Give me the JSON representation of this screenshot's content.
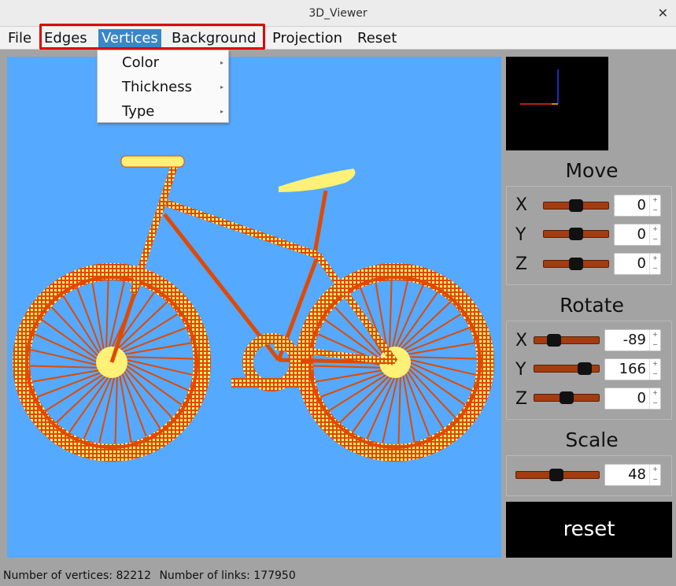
{
  "window": {
    "title": "3D_Viewer"
  },
  "menu": {
    "items": [
      {
        "label": "File"
      },
      {
        "label": "Edges"
      },
      {
        "label": "Vertices"
      },
      {
        "label": "Background"
      },
      {
        "label": "Projection"
      },
      {
        "label": "Reset"
      }
    ],
    "active": "Vertices",
    "dropdown": [
      "Color",
      "Thickness",
      "Type"
    ]
  },
  "colors": {
    "viewport_background": "#55a9ff",
    "edges": "#e04a00",
    "vertices": "#fff176",
    "slider": "#a33c10",
    "highlight": "#e00000",
    "menu_active": "#3a86c8"
  },
  "controls": {
    "move": {
      "title": "Move",
      "axes": [
        {
          "label": "X",
          "value": "0",
          "level": 0.5
        },
        {
          "label": "Y",
          "value": "0",
          "level": 0.5
        },
        {
          "label": "Z",
          "value": "0",
          "level": 0.5
        }
      ]
    },
    "rotate": {
      "title": "Rotate",
      "axes": [
        {
          "label": "X",
          "value": "-89",
          "level": 0.25
        },
        {
          "label": "Y",
          "value": "166",
          "level": 0.86
        },
        {
          "label": "Z",
          "value": "0",
          "level": 0.5
        }
      ]
    },
    "scale": {
      "title": "Scale",
      "value": "48",
      "level": 0.48
    },
    "reset_label": "reset"
  },
  "status": {
    "vertices": "Number of vertices: 82212",
    "links": "Number of links: 177950"
  }
}
